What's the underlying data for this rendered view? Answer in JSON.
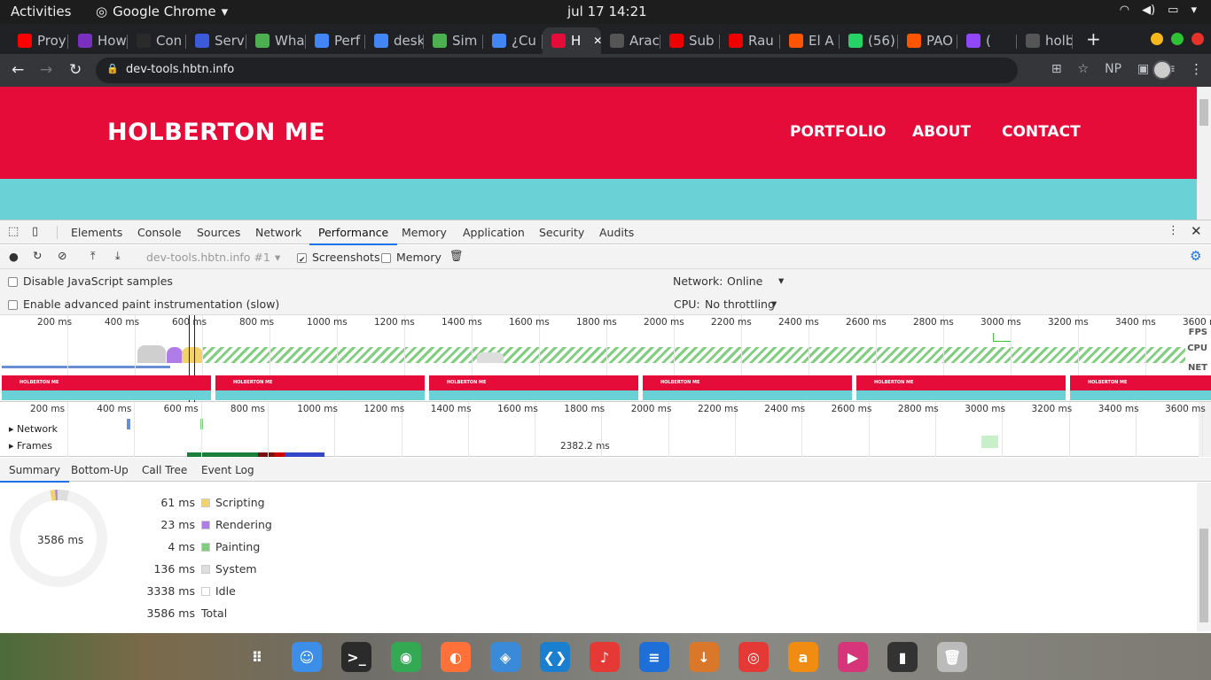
{
  "system_bar": {
    "activities": "Activities",
    "app_name": "Google Chrome",
    "clock": "jul 17  14:21"
  },
  "tabs": [
    {
      "title": "Proy",
      "favicon": "red",
      "icon": "holberton-icon"
    },
    {
      "title": "How",
      "favicon": "#7b2fbe",
      "icon": "web-icon"
    },
    {
      "title": "Con",
      "favicon": "#2a2a2a",
      "icon": "w3schools-icon"
    },
    {
      "title": "Serv",
      "favicon": "#3b5bdb",
      "icon": "terminal-icon"
    },
    {
      "title": "Wha",
      "favicon": "#4caf50",
      "icon": "code-icon"
    },
    {
      "title": "Perf",
      "favicon": "#4285f4",
      "icon": "google-icon"
    },
    {
      "title": "desk",
      "favicon": "#4285f4",
      "icon": "google-icon"
    },
    {
      "title": "Sim",
      "favicon": "#4caf50",
      "icon": "code-icon"
    },
    {
      "title": "¿Cu",
      "favicon": "#4285f4",
      "icon": "google-icon"
    },
    {
      "title": "H",
      "favicon": "#e60c3a",
      "icon": "holberton-icon"
    },
    {
      "title": "Arac",
      "favicon": "#555",
      "icon": "github-icon"
    },
    {
      "title": "Sub",
      "favicon": "#e00",
      "icon": "youtube-icon"
    },
    {
      "title": "Rau",
      "favicon": "#e00",
      "icon": "youtube-icon"
    },
    {
      "title": "El A",
      "favicon": "#f50",
      "icon": "soundcloud-icon"
    },
    {
      "title": "(56)",
      "favicon": "#25d366",
      "icon": "whatsapp-icon"
    },
    {
      "title": "PAO",
      "favicon": "#f50",
      "icon": "soundcloud-icon"
    },
    {
      "title": "(",
      "favicon": "#9146ff",
      "icon": "twitch-icon"
    },
    {
      "title": "holb",
      "favicon": "#555",
      "icon": "github-icon"
    }
  ],
  "address": {
    "url": "dev-tools.hbtn.info",
    "extension_label": "NP"
  },
  "website": {
    "logo": "HOLBERTON ME",
    "nav": [
      "PORTFOLIO",
      "ABOUT",
      "CONTACT"
    ],
    "header_color": "#e60c3a",
    "body_color": "#6ad1d6"
  },
  "devtools": {
    "tabs": [
      "Elements",
      "Console",
      "Sources",
      "Network",
      "Performance",
      "Memory",
      "Application",
      "Security",
      "Audits"
    ],
    "active_tab": "Performance",
    "recording_select": "dev-tools.hbtn.info #1",
    "screenshots_label": "Screenshots",
    "memory_label": "Memory",
    "disable_js_samples": "Disable JavaScript samples",
    "advanced_paint": "Enable advanced paint instrumentation (slow)",
    "network_label": "Network:",
    "network_value": "Online",
    "cpu_label": "CPU:",
    "cpu_value": "No throttling",
    "overview_ticks": [
      "200 ms",
      "400 ms",
      "600 ms",
      "800 ms",
      "1000 ms",
      "1200 ms",
      "1400 ms",
      "1600 ms",
      "1800 ms",
      "2000 ms",
      "2200 ms",
      "2400 ms",
      "2600 ms",
      "2800 ms",
      "3000 ms",
      "3200 ms",
      "3400 ms",
      "3600 m"
    ],
    "overview_labels": [
      "FPS",
      "CPU",
      "NET"
    ],
    "flame_ticks": [
      "200 ms",
      "400 ms",
      "600 ms",
      "800 ms",
      "1000 ms",
      "1200 ms",
      "1400 ms",
      "1600 ms",
      "1800 ms",
      "2000 ms",
      "2200 ms",
      "2400 ms",
      "2600 ms",
      "2800 ms",
      "3000 ms",
      "3200 ms",
      "3400 ms",
      "3600 ms"
    ],
    "tracks": [
      "Network",
      "Frames"
    ],
    "frame_duration": "2382.2 ms",
    "bottom_tabs": [
      "Summary",
      "Bottom-Up",
      "Call Tree",
      "Event Log"
    ],
    "active_bottom_tab": "Summary",
    "total_label": "3586 ms",
    "summary": [
      {
        "ms": "61 ms",
        "label": "Scripting",
        "color": "#f2d36b",
        "value": 61
      },
      {
        "ms": "23 ms",
        "label": "Rendering",
        "color": "#af7ce8",
        "value": 23
      },
      {
        "ms": "4 ms",
        "label": "Painting",
        "color": "#7fcf7f",
        "value": 4
      },
      {
        "ms": "136 ms",
        "label": "System",
        "color": "#dedede",
        "value": 136
      },
      {
        "ms": "3338 ms",
        "label": "Idle",
        "color": "#ffffff",
        "value": 3338
      },
      {
        "ms": "3586 ms",
        "label": "Total",
        "color": "",
        "value": 3586
      }
    ]
  },
  "dock": [
    {
      "name": "apps-grid-icon",
      "color": "transparent",
      "glyph": "⠿"
    },
    {
      "name": "files-icon",
      "color": "#3d8ee8",
      "glyph": "☺"
    },
    {
      "name": "terminal-icon",
      "color": "#2b2b2b",
      "glyph": ">_"
    },
    {
      "name": "chrome-icon",
      "color": "#34a853",
      "glyph": "◉"
    },
    {
      "name": "firefox-icon",
      "color": "#ff7139",
      "glyph": "◐"
    },
    {
      "name": "dns-icon",
      "color": "#3b8ad8",
      "glyph": "◈"
    },
    {
      "name": "vscode-icon",
      "color": "#1a7fcf",
      "glyph": "❮❯"
    },
    {
      "name": "music-icon",
      "color": "#e53935",
      "glyph": "♪"
    },
    {
      "name": "writer-icon",
      "color": "#1e6fd8",
      "glyph": "≡"
    },
    {
      "name": "download-icon",
      "color": "#d9782a",
      "glyph": "↓"
    },
    {
      "name": "help-icon",
      "color": "#e53935",
      "glyph": "◎"
    },
    {
      "name": "amazon-icon",
      "color": "#f08c12",
      "glyph": "a"
    },
    {
      "name": "video-editor-icon",
      "color": "#d6357a",
      "glyph": "▶"
    },
    {
      "name": "phone-icon",
      "color": "#333",
      "glyph": "▮"
    },
    {
      "name": "trash-icon",
      "color": "#bbb",
      "glyph": "🗑"
    }
  ]
}
